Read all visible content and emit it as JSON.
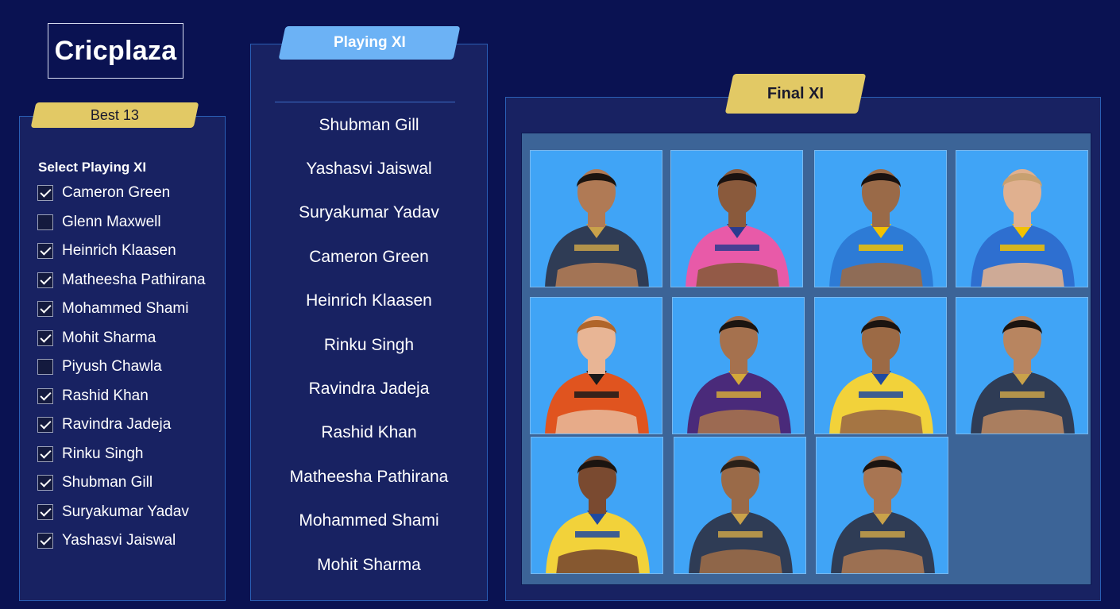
{
  "brand": {
    "name": "Cricplaza"
  },
  "best13": {
    "tag_label": "Best 13",
    "select_title": "Select Playing XI",
    "players": [
      {
        "name": "Cameron Green",
        "checked": true
      },
      {
        "name": "Glenn Maxwell",
        "checked": false
      },
      {
        "name": "Heinrich Klaasen",
        "checked": true
      },
      {
        "name": "Matheesha Pathirana",
        "checked": true
      },
      {
        "name": "Mohammed Shami",
        "checked": true
      },
      {
        "name": "Mohit Sharma",
        "checked": true
      },
      {
        "name": "Piyush Chawla",
        "checked": false
      },
      {
        "name": "Rashid Khan",
        "checked": true
      },
      {
        "name": "Ravindra Jadeja",
        "checked": true
      },
      {
        "name": "Rinku Singh",
        "checked": true
      },
      {
        "name": "Shubman Gill",
        "checked": true
      },
      {
        "name": "Suryakumar Yadav",
        "checked": true
      },
      {
        "name": "Yashasvi Jaiswal",
        "checked": true
      }
    ]
  },
  "playing_xi": {
    "tag_label": "Playing XI",
    "players": [
      "Shubman Gill",
      "Yashasvi Jaiswal",
      "Suryakumar Yadav",
      "Cameron Green",
      "Heinrich Klaasen",
      "Rinku Singh",
      "Ravindra Jadeja",
      "Rashid Khan",
      "Matheesha Pathirana",
      "Mohammed Shami",
      "Mohit Sharma"
    ]
  },
  "final_xi": {
    "tag_label": "Final XI",
    "cards": [
      {
        "jersey": "#2f3c55",
        "accent": "#c9a24a",
        "skin": "#b07a55",
        "hair": "#1b1410"
      },
      {
        "jersey": "#e85aa8",
        "accent": "#2a3b8f",
        "skin": "#8a5a3c",
        "hair": "#1a1210"
      },
      {
        "jersey": "#2d7bd6",
        "accent": "#f2c200",
        "skin": "#9a6a48",
        "hair": "#1a1210"
      },
      {
        "jersey": "#2e6fd0",
        "accent": "#f2c200",
        "skin": "#e0b08f",
        "hair": "#c8a070"
      },
      {
        "jersey": "#e0541f",
        "accent": "#1a1a1a",
        "skin": "#e8b595",
        "hair": "#b0652a"
      },
      {
        "jersey": "#4a2a7a",
        "accent": "#d4a83a",
        "skin": "#a5714e",
        "hair": "#1b1410"
      },
      {
        "jersey": "#f2d23a",
        "accent": "#1f4aa0",
        "skin": "#9c6a45",
        "hair": "#1b1410"
      },
      {
        "jersey": "#2f3c55",
        "accent": "#c9a24a",
        "skin": "#b88560",
        "hair": "#1b1410"
      },
      {
        "jersey": "#f2d23a",
        "accent": "#1f4aa0",
        "skin": "#7a4a30",
        "hair": "#1b1410"
      },
      {
        "jersey": "#2f3c55",
        "accent": "#c9a24a",
        "skin": "#9a6a48",
        "hair": "#2a2018"
      },
      {
        "jersey": "#2f3c55",
        "accent": "#c9a24a",
        "skin": "#a87552",
        "hair": "#1b1410"
      }
    ]
  }
}
